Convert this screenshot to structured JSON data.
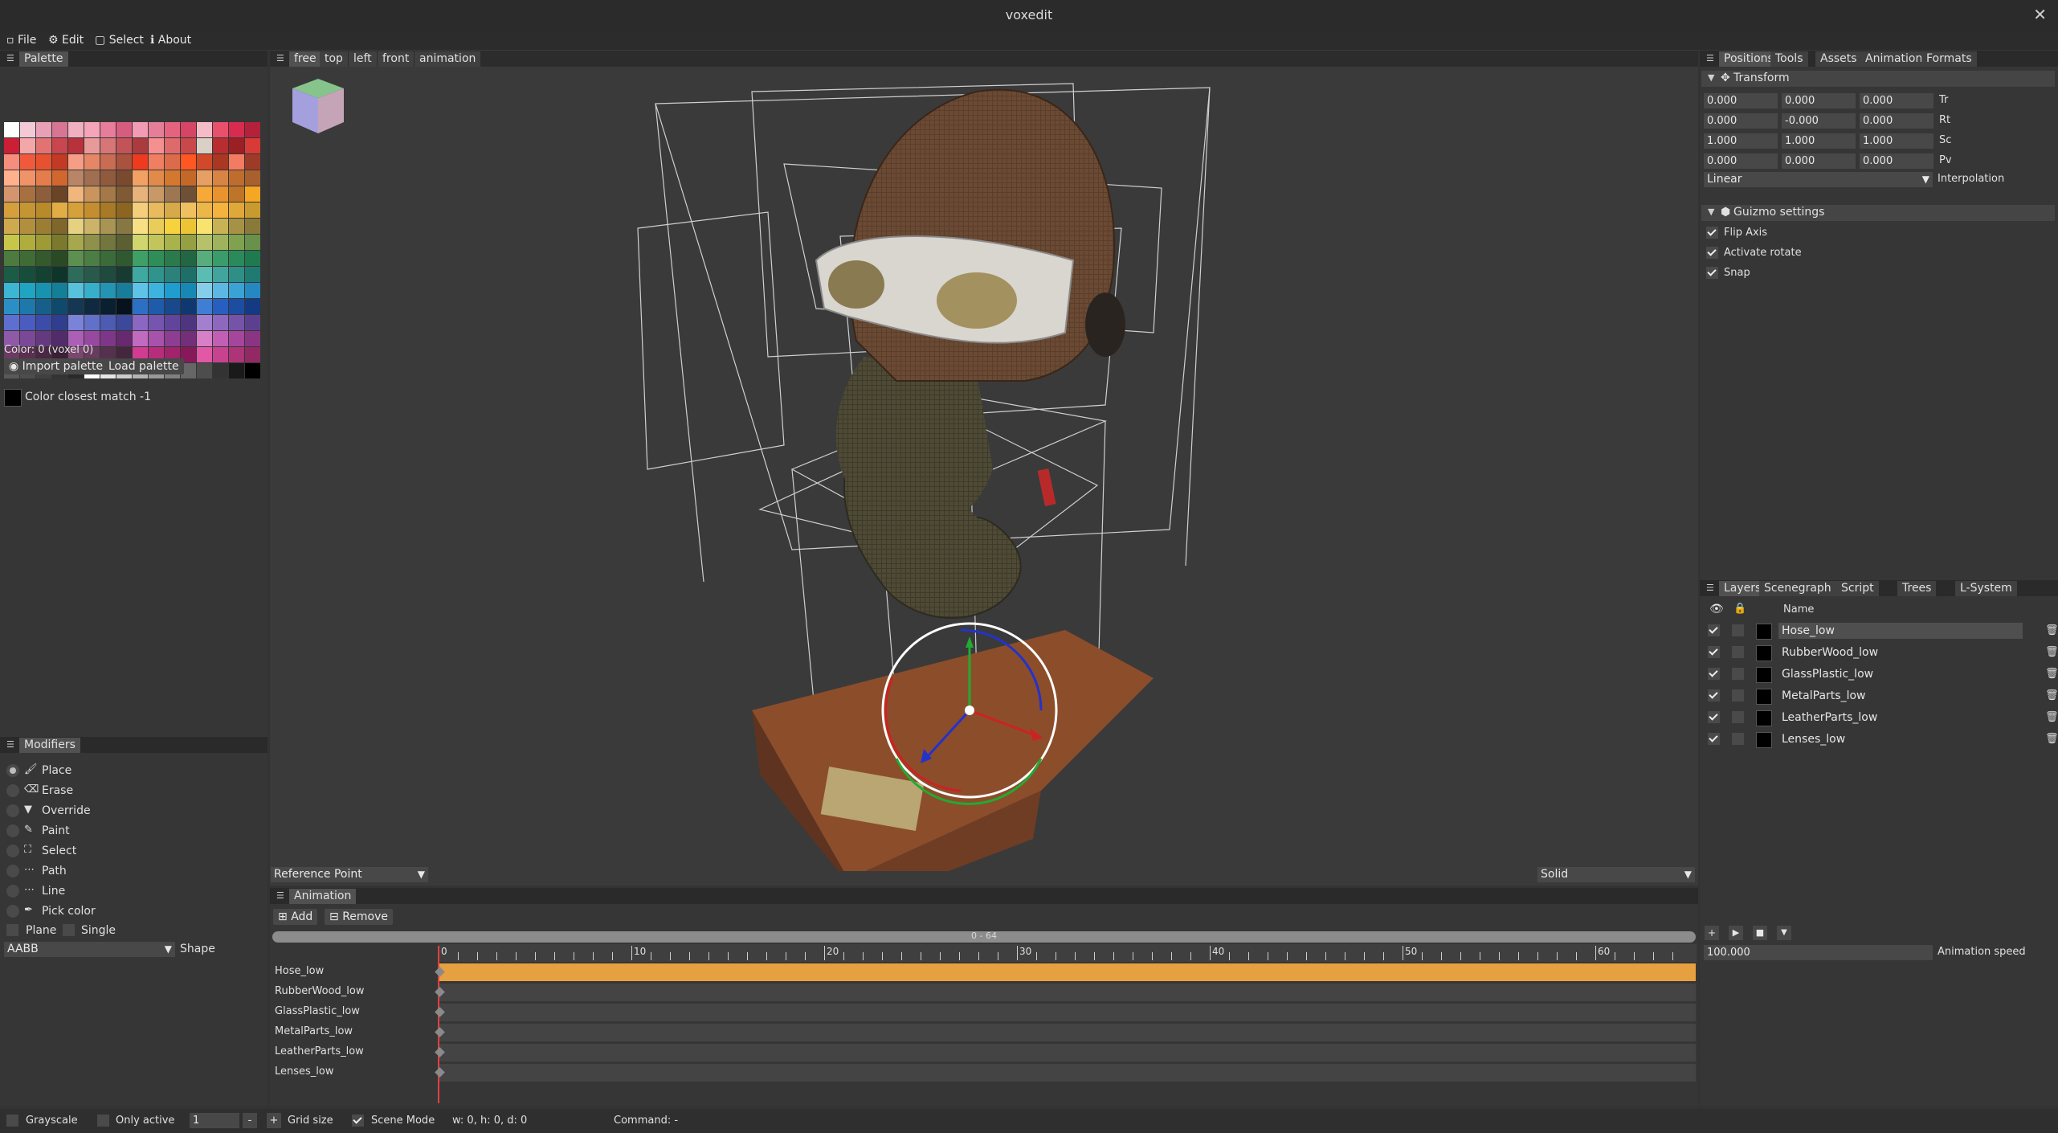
{
  "window": {
    "title": "voxedit",
    "close_glyph": "✕"
  },
  "menu": [
    {
      "label": "File",
      "icon": "file-icon"
    },
    {
      "label": "Edit",
      "icon": "gear-icon"
    },
    {
      "label": "Select",
      "icon": "select-icon"
    },
    {
      "label": "About",
      "icon": "info-icon"
    }
  ],
  "palette": {
    "tab": "Palette",
    "color_text": "Color: 0 (voxel 0)",
    "import_label": "Import palette",
    "load_label": "Load palette",
    "closest_label": "Color closest match",
    "closest_value": "-1",
    "colors": [
      "#ffffff",
      "#f3c9d6",
      "#e8a0b6",
      "#d87494",
      "#f0b0c0",
      "#f4a5b9",
      "#e77c9b",
      "#d85c80",
      "#f39bb4",
      "#e57f99",
      "#e6637f",
      "#d64565",
      "#f5bcc8",
      "#e8506c",
      "#d92b4f",
      "#b5203a",
      "#cc1f36",
      "#f3a7a9",
      "#e37373",
      "#c8464d",
      "#b8323c",
      "#e79a99",
      "#d77676",
      "#c25458",
      "#aa3b3f",
      "#f59090",
      "#de6b6b",
      "#c9484a",
      "#dad0c5",
      "#b82d2e",
      "#9a2023",
      "#d83b37",
      "#f78d7c",
      "#f05a3a",
      "#e8512f",
      "#c23a24",
      "#f59e85",
      "#e58667",
      "#c96c54",
      "#a9523d",
      "#ee3b1f",
      "#f07e62",
      "#dc6b4b",
      "#ff5722",
      "#d2492a",
      "#a93722",
      "#f37b62",
      "#9d3b28",
      "#ffb08d",
      "#f09368",
      "#e47c4b",
      "#d1662f",
      "#b88666",
      "#a06e51",
      "#8f5a3d",
      "#7a4a2f",
      "#f3a065",
      "#e18a4a",
      "#d5782f",
      "#c4682a",
      "#e79f64",
      "#d78445",
      "#bf6d2f",
      "#a8602d",
      "#d4956e",
      "#a87040",
      "#8c5e3b",
      "#6b4326",
      "#f0b67e",
      "#c9955d",
      "#a57848",
      "#7f5a34",
      "#e8b27b",
      "#c89867",
      "#9c7752",
      "#6e5037",
      "#f6a838",
      "#e8932d",
      "#bf7527",
      "#f5a623",
      "#d59f3d",
      "#c69533",
      "#b88a2a",
      "#e2ad45",
      "#d6a03a",
      "#c48e30",
      "#a87926",
      "#8c6620",
      "#f4ce7a",
      "#e9bb5e",
      "#d6a94a",
      "#f0c060",
      "#ebb64a",
      "#f3b33d",
      "#e0a838",
      "#c99a2e",
      "#cfa94e",
      "#b28f3f",
      "#9b7d34",
      "#7f672b",
      "#e6d081",
      "#cbb468",
      "#a99553",
      "#877743",
      "#f7e083",
      "#e9cc5a",
      "#f6d33e",
      "#ecc434",
      "#f8e36e",
      "#c7b355",
      "#a59244",
      "#8a7a3a",
      "#c8c64a",
      "#b0ad3f",
      "#9e9a36",
      "#7b7a2c",
      "#a7a84e",
      "#8f914a",
      "#73773d",
      "#5b5f31",
      "#d1d56e",
      "#c2c65a",
      "#a9b34b",
      "#94a041",
      "#b5c269",
      "#9fb35c",
      "#7fa24f",
      "#69914a",
      "#4c7a3f",
      "#3f6b35",
      "#33592c",
      "#2a4a25",
      "#5c8f50",
      "#4c7d44",
      "#3a6b39",
      "#2f5a30",
      "#3fa065",
      "#2f8e58",
      "#2a7a4c",
      "#216743",
      "#58ad7c",
      "#3b9c6b",
      "#2b8a5c",
      "#1f7a4f",
      "#1a5c45",
      "#174e3b",
      "#134132",
      "#0f3429",
      "#2d6b5b",
      "#28594b",
      "#1f4a3e",
      "#173a31",
      "#3fa8a0",
      "#2e948c",
      "#2a827b",
      "#1e6f68",
      "#5bbcb4",
      "#42a59d",
      "#2f8f86",
      "#1f7b72",
      "#3cb6d2",
      "#1fa4c2",
      "#1893af",
      "#147f98",
      "#58c1dc",
      "#37aeca",
      "#2494b3",
      "#197d99",
      "#5fc3e8",
      "#3db3de",
      "#1e9dce",
      "#1788b4",
      "#86cdea",
      "#5eb7e0",
      "#3ba2d4",
      "#2588c0",
      "#2a8fc4",
      "#1d78ab",
      "#165f8b",
      "#0f4a6c",
      "#163753",
      "#0f2a40",
      "#0a1f30",
      "#06131e",
      "#2c6fc4",
      "#1f5bab",
      "#17498c",
      "#0f3870",
      "#3e7ed4",
      "#275fc0",
      "#1d4ca3",
      "#143a86",
      "#5d6fd1",
      "#4a5cc0",
      "#3b4ca9",
      "#2f3e8e",
      "#7b83d9",
      "#6370c8",
      "#4e5bb3",
      "#3c489a",
      "#8a67c2",
      "#7655b0",
      "#61449b",
      "#4d3580",
      "#a37fd0",
      "#8d68bf",
      "#7553a9",
      "#5c4090",
      "#8e5aa8",
      "#7a4896",
      "#653980",
      "#522c6a",
      "#ab5fb6",
      "#96499f",
      "#7e3788",
      "#67296f",
      "#c06bc0",
      "#a752ab",
      "#8d3d92",
      "#732f77",
      "#d77fc7",
      "#c05fb3",
      "#a5469c",
      "#8a3583",
      "#6b3b63",
      "#5a3052",
      "#4a2743",
      "#3b1f35",
      "#7a476e",
      "#683c5e",
      "#55314d",
      "#43273d",
      "#d13b91",
      "#b82c7d",
      "#a1236c",
      "#87195a",
      "#e158a6",
      "#c8438f",
      "#ad3479",
      "#932964",
      "#595959",
      "#4d4d4d",
      "#404040",
      "#333333",
      "#2a2a2a",
      "#ffffff",
      "#e6e6e6",
      "#cccccc",
      "#b3b3b3",
      "#999999",
      "#808080",
      "#666666",
      "#4d4d4d",
      "#333333",
      "#1a1a1a",
      "#000000"
    ]
  },
  "modifiers": {
    "tab": "Modifiers",
    "items": [
      {
        "label": "Place",
        "icon": "brush-icon",
        "selected": true
      },
      {
        "label": "Erase",
        "icon": "eraser-icon",
        "selected": false
      },
      {
        "label": "Override",
        "icon": "filter-icon",
        "selected": false
      },
      {
        "label": "Paint",
        "icon": "paint-brush-icon",
        "selected": false
      },
      {
        "label": "Select",
        "icon": "select-icon",
        "selected": false
      },
      {
        "label": "Path",
        "icon": "dots-icon",
        "selected": false
      },
      {
        "label": "Line",
        "icon": "dots-icon",
        "selected": false
      },
      {
        "label": "Pick color",
        "icon": "eyedropper-icon",
        "selected": false
      }
    ],
    "plane_label": "Plane",
    "single_label": "Single",
    "shape_value": "AABB",
    "shape_label": "Shape"
  },
  "viewport": {
    "tabs": [
      "free",
      "top",
      "left",
      "front",
      "animation"
    ],
    "active_tab": "free",
    "reference_point": "Reference Point",
    "render_mode": "Solid"
  },
  "transform": {
    "tabs": [
      "Positions",
      "Tools",
      "Assets",
      "Animation",
      "Formats"
    ],
    "active_tab": "Positions",
    "section": "Transform",
    "rows": [
      {
        "values": [
          "0.000",
          "0.000",
          "0.000"
        ],
        "label": "Tr"
      },
      {
        "values": [
          "0.000",
          "-0.000",
          "0.000"
        ],
        "label": "Rt"
      },
      {
        "values": [
          "1.000",
          "1.000",
          "1.000"
        ],
        "label": "Sc"
      },
      {
        "values": [
          "0.000",
          "0.000",
          "0.000"
        ],
        "label": "Pv"
      }
    ],
    "interpolation_value": "Linear",
    "interpolation_label": "Interpolation",
    "gizmo_section": "Guizmo settings",
    "gizmo_options": [
      {
        "label": "Flip Axis",
        "checked": true
      },
      {
        "label": "Activate rotate",
        "checked": true
      },
      {
        "label": "Snap",
        "checked": true
      }
    ]
  },
  "layers": {
    "tabs": [
      "Layers",
      "Scenegraph",
      "Script",
      "Trees",
      "L-System"
    ],
    "active_tab": "Layers",
    "name_header": "Name",
    "rows": [
      {
        "name": "Hose_low",
        "visible": true,
        "selected": true
      },
      {
        "name": "RubberWood_low",
        "visible": true,
        "selected": false
      },
      {
        "name": "GlassPlastic_low",
        "visible": true,
        "selected": false
      },
      {
        "name": "MetalParts_low",
        "visible": true,
        "selected": false
      },
      {
        "name": "LeatherParts_low",
        "visible": true,
        "selected": false
      },
      {
        "name": "Lenses_low",
        "visible": true,
        "selected": false
      }
    ],
    "animation_speed_value": "100.000",
    "animation_speed_label": "Animation speed"
  },
  "animation": {
    "tab": "Animation",
    "add_label": "Add",
    "remove_label": "Remove",
    "range_label": "0 - 64",
    "ruler_labels": [
      "0",
      "10",
      "20",
      "30",
      "40",
      "50",
      "60"
    ],
    "tracks": [
      "Hose_low",
      "RubberWood_low",
      "GlassPlastic_low",
      "MetalParts_low",
      "LeatherParts_low",
      "Lenses_low"
    ],
    "bar_color": "#e7a040"
  },
  "statusbar": {
    "grayscale_label": "Grayscale",
    "only_active_label": "Only active",
    "grid_value": "1",
    "minus": "-",
    "plus": "+",
    "grid_label": "Grid size",
    "scene_mode_label": "Scene Mode",
    "dims": "w: 0, h: 0, d: 0",
    "command": "Command: -"
  },
  "colors": {
    "bg": "#333333",
    "panel": "#363636",
    "header": "#2a2a2a",
    "accent": "#e7a040"
  }
}
